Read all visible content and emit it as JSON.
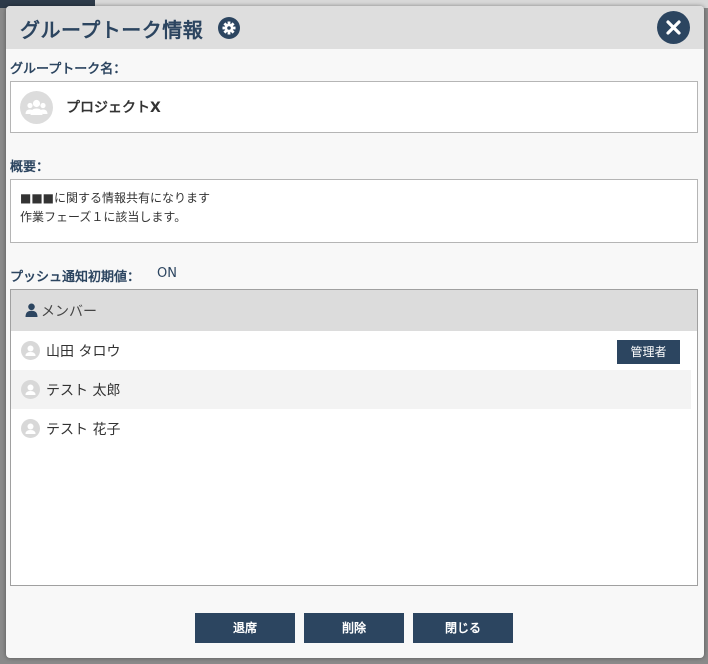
{
  "dialog": {
    "title": "グループトーク情報"
  },
  "group": {
    "name_label": "グループトーク名：",
    "name": "プロジェクトX",
    "summary_label": "概要：",
    "summary_line1": "■■■に関する情報共有になります",
    "summary_line2": "作業フェーズ１に該当します。",
    "push_label": "プッシュ通知初期値：",
    "push_value": "ON"
  },
  "members": {
    "header": "メンバー",
    "list": [
      {
        "name": "山田 タロウ",
        "badge": "管理者"
      },
      {
        "name": "テスト 太郎"
      },
      {
        "name": "テスト 花子"
      }
    ]
  },
  "buttons": {
    "leave": "退席",
    "delete": "削除",
    "close": "閉じる"
  },
  "colors": {
    "accent": "#2c4560",
    "header_bg": "#dedede"
  }
}
